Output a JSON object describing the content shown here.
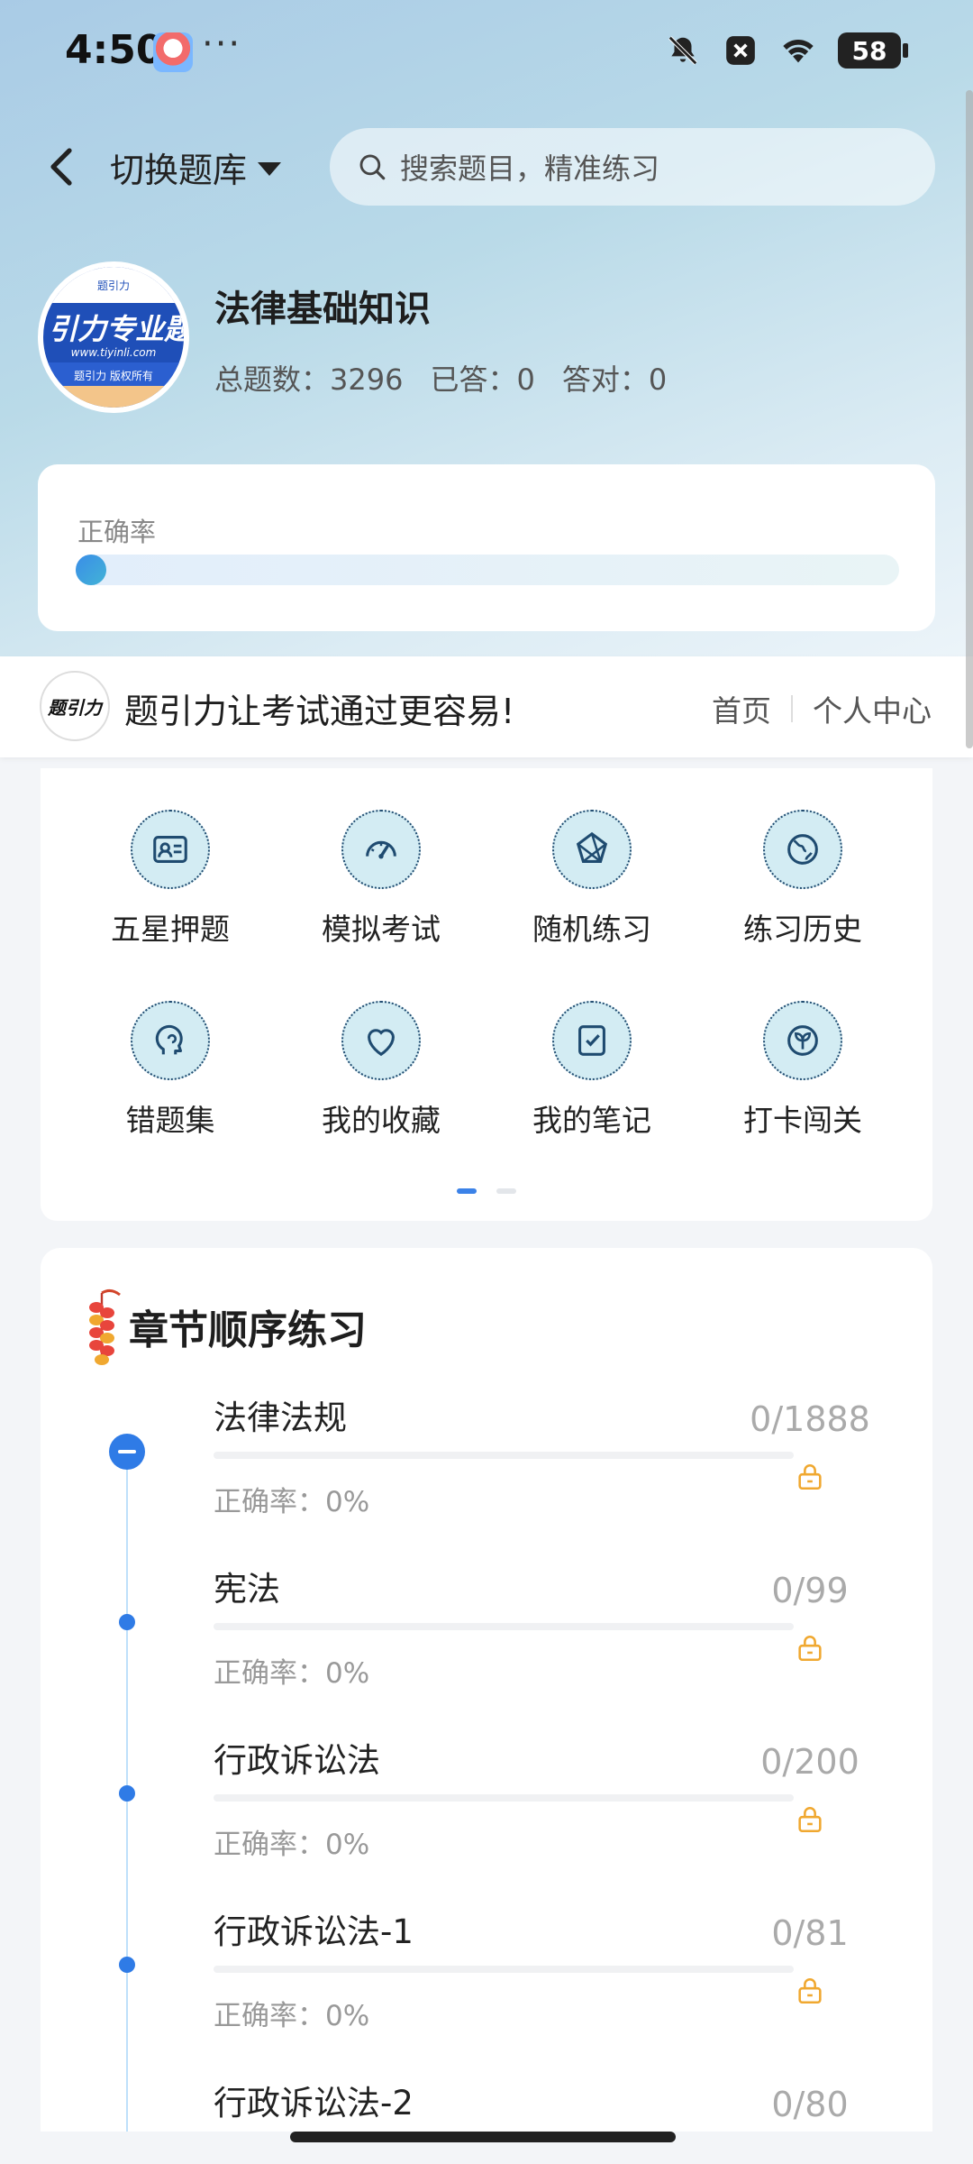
{
  "status_bar": {
    "time": "4:50",
    "dots": "···",
    "battery": "58",
    "icons": [
      "bell-off-icon",
      "close-box-icon",
      "wifi-icon",
      "battery-icon"
    ]
  },
  "header": {
    "switch_bank_label": "切换题库",
    "search_placeholder": "搜索题目，精准练习"
  },
  "bank": {
    "logo_top": "题引力",
    "logo_main": "引力专业题",
    "logo_url": "www.tiyinli.com",
    "logo_band": "题引力 版权所有",
    "title": "法律基础知识",
    "stats": {
      "total": "总题数：3296",
      "answered": "已答：0",
      "correct": "答对：0"
    }
  },
  "accuracy_card": {
    "label": "正确率",
    "value": 0
  },
  "promo": {
    "logo_text": "题引力",
    "text": "题引力让考试通过更容易!",
    "links": [
      "首页",
      "个人中心"
    ]
  },
  "grid": {
    "items": [
      {
        "label": "五星押题",
        "icon": "id-card-icon"
      },
      {
        "label": "模拟考试",
        "icon": "speedometer-icon"
      },
      {
        "label": "随机练习",
        "icon": "network-icon"
      },
      {
        "label": "练习历史",
        "icon": "globe-icon"
      },
      {
        "label": "错题集",
        "icon": "head-profile-icon"
      },
      {
        "label": "我的收藏",
        "icon": "heart-icon"
      },
      {
        "label": "我的笔记",
        "icon": "note-check-icon"
      },
      {
        "label": "打卡闯关",
        "icon": "sprout-icon"
      }
    ],
    "page": 1,
    "pages": 2
  },
  "chapters": {
    "title": "章节顺序练习",
    "items": [
      {
        "name": "法律法规",
        "accuracy": "正确率：0%",
        "count": "0/1888"
      },
      {
        "name": "宪法",
        "accuracy": "正确率：0%",
        "count": "0/99"
      },
      {
        "name": "行政诉讼法",
        "accuracy": "正确率：0%",
        "count": "0/200"
      },
      {
        "name": "行政诉讼法-1",
        "accuracy": "正确率：0%",
        "count": "0/81"
      },
      {
        "name": "行政诉讼法-2",
        "accuracy": "",
        "count": "0/80"
      }
    ]
  },
  "colors": {
    "accent": "#2f7be6",
    "lock": "#f0a830",
    "hero_bg": "#b9dae8"
  }
}
